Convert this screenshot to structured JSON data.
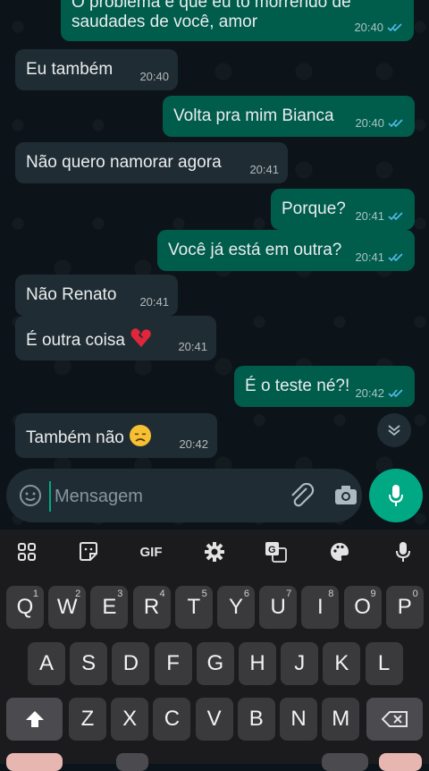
{
  "messages": [
    {
      "dir": "out",
      "text": "O problema é que eu tô morrendo de",
      "text2": "saudades de você, amor",
      "time": "20:40",
      "read": true
    },
    {
      "dir": "in",
      "text": "Eu também",
      "time": "20:40"
    },
    {
      "dir": "out",
      "text": "Volta pra mim Bianca",
      "time": "20:40",
      "read": true
    },
    {
      "dir": "in",
      "text": "Não quero namorar agora",
      "time": "20:41"
    },
    {
      "dir": "out",
      "text": "Porque?",
      "time": "20:41",
      "read": true
    },
    {
      "dir": "out",
      "text": "Você já está em outra?",
      "time": "20:41",
      "read": true
    },
    {
      "dir": "in",
      "text": "Não Renato",
      "time": "20:41"
    },
    {
      "dir": "in",
      "text": "É outra coisa",
      "emoji": "broken-heart",
      "time": "20:41"
    },
    {
      "dir": "out",
      "text": "É o teste né?!",
      "time": "20:42",
      "read": true
    },
    {
      "dir": "in",
      "text": "Também não",
      "emoji": "disappointed-face",
      "time": "20:42"
    }
  ],
  "composer": {
    "placeholder": "Mensagem"
  },
  "keyboard": {
    "toolbar": [
      "apps-grid-icon",
      "sticker-icon",
      "GIF",
      "settings-gear-icon",
      "translate-icon",
      "palette-icon",
      "keyboard-mic-icon"
    ],
    "gif_label": "GIF",
    "row1": [
      [
        "Q",
        "1"
      ],
      [
        "W",
        "2"
      ],
      [
        "E",
        "3"
      ],
      [
        "R",
        "4"
      ],
      [
        "T",
        "5"
      ],
      [
        "Y",
        "6"
      ],
      [
        "U",
        "7"
      ],
      [
        "I",
        "8"
      ],
      [
        "O",
        "9"
      ],
      [
        "P",
        "0"
      ]
    ],
    "row2": [
      "A",
      "S",
      "D",
      "F",
      "G",
      "H",
      "J",
      "K",
      "L"
    ],
    "row3": [
      "Z",
      "X",
      "C",
      "V",
      "B",
      "N",
      "M"
    ]
  },
  "colors": {
    "outgoing": "#005c4b",
    "incoming": "#202c33",
    "accent": "#00a884",
    "read_ticks": "#53bdeb"
  }
}
